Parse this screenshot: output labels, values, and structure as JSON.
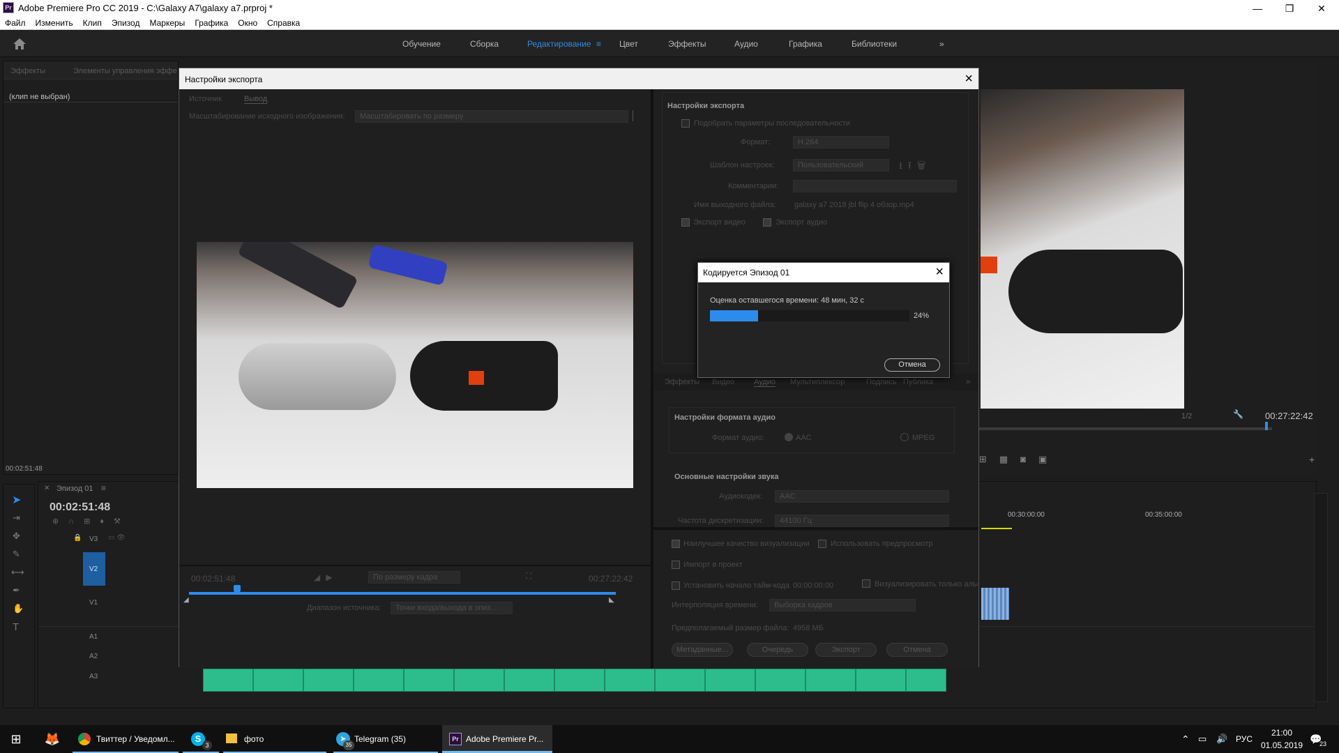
{
  "window": {
    "title": "Adobe Premiere Pro CC 2019 - C:\\Galaxy A7\\galaxy a7.prproj *",
    "app_icon": "Pr",
    "controls": [
      "—",
      "❐",
      "✕"
    ]
  },
  "menu": [
    "Файл",
    "Изменить",
    "Клип",
    "Эпизод",
    "Маркеры",
    "Графика",
    "Окно",
    "Справка"
  ],
  "workspaces": {
    "tabs": [
      "Обучение",
      "Сборка",
      "Редактирование",
      "Цвет",
      "Эффекты",
      "Аудио",
      "Графика",
      "Библиотеки"
    ],
    "active": "Редактирование",
    "more": "»"
  },
  "left_panel": {
    "tabs": [
      "Эффекты",
      "Элементы управления эффе"
    ],
    "no_clip": "(клип не выбран)",
    "timecode": "00:02:51:48"
  },
  "timeline": {
    "sequence_tab": "Эпизод 01",
    "timecode": "00:02:51:48",
    "tracks": [
      "V3",
      "V2",
      "V1",
      "A1",
      "A2",
      "A3"
    ],
    "ruler": [
      "00:30:00:00",
      "00:35:00:00"
    ]
  },
  "program_monitor": {
    "timecode": "00:27:22:42",
    "zoom": "1/2"
  },
  "export_dialog": {
    "title": "Настройки экспорта",
    "tabs": [
      "Источник",
      "Вывод"
    ],
    "scaling_label": "Масштабирование исходного изображения:",
    "scaling_value": "Масштабировать по размеру",
    "preview_timecode_left": "00:02:51:48",
    "preview_timecode_right": "00:27:22:42",
    "fit_value": "По размеру кадра",
    "source_range_label": "Диапазон источника:",
    "source_range_value": "Точки входа/выхода в эпиз...",
    "settings_section": "Настройки экспорта",
    "match_sequence": "Подобрать параметры последовательности",
    "format_label": "Формат:",
    "format_value": "H.264",
    "preset_label": "Шаблон настроек:",
    "preset_value": "Пользовательский",
    "comments_label": "Комментарии:",
    "output_name_label": "Имя выходного файла:",
    "output_name_value": "galaxy a7 2018 jbl flip 4 обзор.mp4",
    "export_video": "Экспорт видео",
    "export_audio": "Экспорт аудио",
    "sub_tabs": [
      "Эффекты",
      "Видео",
      "Аудио",
      "Мультиплексор",
      "Подпись",
      "Публика"
    ],
    "audio_format_section": "Настройки формата аудио",
    "audio_format_label": "Формат аудио:",
    "audio_format_options": [
      "AAC",
      "MPEG"
    ],
    "basic_audio_section": "Основные настройки звука",
    "audio_codec_label": "Аудиокодек:",
    "audio_codec_value": "AAC",
    "sample_rate_label": "Частота дискретизации:",
    "sample_rate_value": "44100 Гц",
    "max_quality": "Наилучшее качество визуализации",
    "use_previews": "Использовать предпросмотр",
    "import_project": "Импорт в проект",
    "set_start_tc": "Установить начало тайм-кода",
    "start_tc_value": "00:00:00:00",
    "render_alpha": "Визуализировать только альфа",
    "time_interp_label": "Интерполяция времени:",
    "time_interp_value": "Выборка кадров",
    "file_size_label": "Предполагаемый размер файла:",
    "file_size_value": "4958 МБ",
    "buttons": [
      "Метаданные...",
      "Очередь",
      "Экспорт",
      "Отмена"
    ]
  },
  "encoding_dialog": {
    "title": "Кодируется Эпизод 01",
    "eta": "Оценка оставшегося времени: 48 мин, 32 с",
    "progress": 0.24,
    "progress_label": "24%",
    "cancel": "Отмена"
  },
  "taskbar": {
    "items": [
      {
        "label": "Твиттер / Уведомл...",
        "icon": "chrome-icon"
      },
      {
        "label": "",
        "icon": "skype-icon",
        "badge": "3"
      },
      {
        "label": "фото",
        "icon": "folder-icon"
      },
      {
        "label": "Telegram (35)",
        "icon": "telegram-icon",
        "badge": "35"
      },
      {
        "label": "Adobe Premiere Pr...",
        "icon": "premiere-icon"
      }
    ],
    "language": "РУС",
    "time": "21:00",
    "date": "01.05.2019",
    "notifications": "23"
  },
  "colors": {
    "accent": "#2d8ceb",
    "audio_clip": "#2dbd8d",
    "track_v2": "#1d5fa0"
  }
}
